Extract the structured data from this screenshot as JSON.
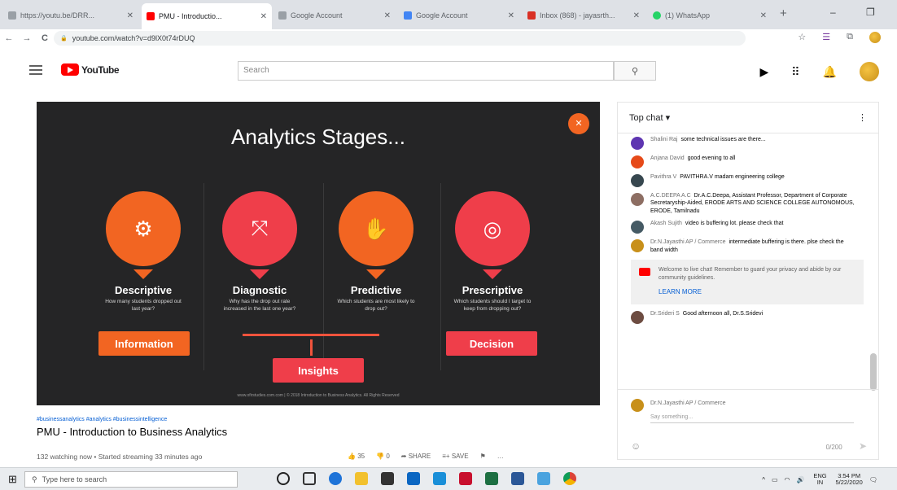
{
  "browser": {
    "tabs": [
      {
        "label": "https://youtu.be/DRR...",
        "color": "#9aa0a6",
        "active": false
      },
      {
        "label": "PMU - Introductio...",
        "color": "#ff0000",
        "active": true
      },
      {
        "label": "Google Account",
        "color": "#9aa0a6",
        "active": false
      },
      {
        "label": "Google Account",
        "color": "#4285f4",
        "active": false
      },
      {
        "label": "Inbox (868) - jayasrth...",
        "color": "#d93025",
        "active": false
      },
      {
        "label": "(1) WhatsApp",
        "color": "#25d366",
        "active": false
      }
    ],
    "url": "youtube.com/watch?v=d9lX0t74rDUQ",
    "new_tab": "+",
    "minimize": "–",
    "restore": "❐",
    "back": "←",
    "forward": "→",
    "reload": "C",
    "lock": "🔒",
    "star": "☆",
    "menu": "⋮"
  },
  "youtube": {
    "logo_text": "YouTube",
    "search_placeholder": "Search",
    "search_icon": "⚲"
  },
  "slide": {
    "title": "Analytics Stages...",
    "corner_button": "✕",
    "stages": [
      {
        "name": "Descriptive",
        "desc": "How many students dropped out last year?",
        "color": "#f26522",
        "icon": "⚙"
      },
      {
        "name": "Diagnostic",
        "desc": "Why has the drop out rate increased in the last one year?",
        "color": "#ef3e4a",
        "icon": "⤧"
      },
      {
        "name": "Predictive",
        "desc": "Which students are most likely to drop out?",
        "color": "#f26522",
        "icon": "✋"
      },
      {
        "name": "Prescriptive",
        "desc": "Which students should I target to keep from dropping out?",
        "color": "#ef3e4a",
        "icon": "◎"
      }
    ],
    "tags": {
      "information": "Information",
      "insights": "Insights",
      "decision": "Decision"
    },
    "footer": "www.ofirstudies.com.com | © 2018 Introduction to Business Analytics. All Rights Reserved"
  },
  "video": {
    "hashtags": "#businessanalytics #analytics #businessintelligence",
    "title": "PMU - Introduction to Business Analytics",
    "meta": "132 watching now • Started streaming 33 minutes ago",
    "likes": "35",
    "dislikes": "0",
    "share": "SHARE",
    "save": "SAVE",
    "more": "…"
  },
  "chat": {
    "header": "Top chat ▾",
    "messages": [
      {
        "author": "Shalini Raj",
        "text": "some technical issues are there...",
        "color": "#5e35b1"
      },
      {
        "author": "Anjana David",
        "text": "good evening to all",
        "color": "#e64a19"
      },
      {
        "author": "Pavithra V",
        "text": "PAVITHRA.V madam engineering college",
        "color": "#37474f"
      },
      {
        "author": "A.C.DEEPA A.C",
        "text": "Dr.A.C.Deepa, Assistant Professor, Department of Corporate Secretaryship-Aided, ERODE ARTS AND SCIENCE COLLEGE AUTONOMOUS, ERODE, Tamilnadu",
        "color": "#8d6e63"
      },
      {
        "author": "Akash Sujith",
        "text": "video is buffering lot. please check that",
        "color": "#455a64"
      },
      {
        "author": "Dr.N.Jayasthi AP / Commerce",
        "text": "intermediate buffering is there. plse check the band width",
        "color": "#c8901a"
      }
    ],
    "notice": "Welcome to live chat! Remember to guard your privacy and abide by our community guidelines.",
    "learn_more": "LEARN MORE",
    "last_message": {
      "author": "Dr.Srideri S",
      "text": "Good afternoon all, Dr.S.Sridevi",
      "color": "#6d4c41"
    },
    "input_author": "Dr.N.Jayasthi AP / Commerce",
    "input_placeholder": "Say something...",
    "emoji": "☺",
    "counter": "0/200",
    "send": "➤"
  },
  "taskbar": {
    "search_placeholder": "Type here to search",
    "lang": "ENG IN",
    "time": "3:54 PM",
    "date": "5/22/2020"
  }
}
